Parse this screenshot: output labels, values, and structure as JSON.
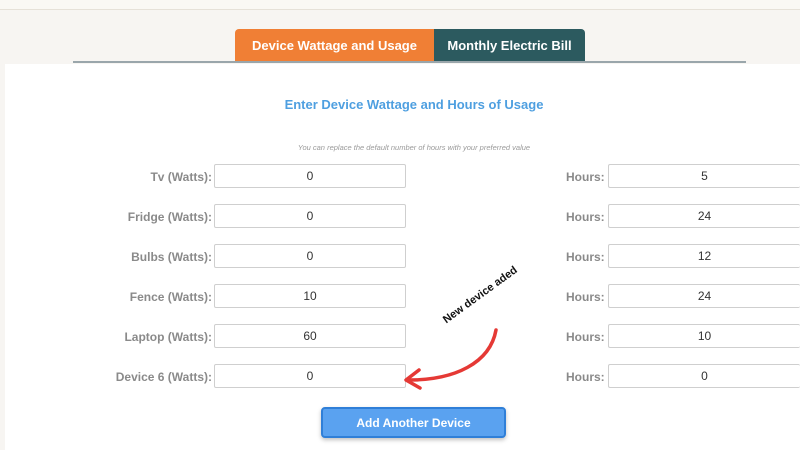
{
  "tabs": {
    "active_label": "Device Wattage and Usage",
    "inactive_label": "Monthly Electric Bill"
  },
  "form": {
    "heading": "Enter Device Wattage and Hours of Usage",
    "hint": "You can replace the default number of hours with your preferred value",
    "hours_label": "Hours:",
    "devices": [
      {
        "label": "Tv (Watts):",
        "watts": "0",
        "hours": "5"
      },
      {
        "label": "Fridge (Watts):",
        "watts": "0",
        "hours": "24"
      },
      {
        "label": "Bulbs (Watts):",
        "watts": "0",
        "hours": "12"
      },
      {
        "label": "Fence (Watts):",
        "watts": "10",
        "hours": "24"
      },
      {
        "label": "Laptop (Watts):",
        "watts": "60",
        "hours": "10"
      },
      {
        "label": "Device 6 (Watts):",
        "watts": "0",
        "hours": "0"
      }
    ],
    "add_button_label": "Add Another Device"
  },
  "annotation": {
    "text": "New device aded",
    "arrow_color": "#e53935"
  },
  "colors": {
    "tab_active": "#f07f35",
    "tab_inactive": "#2c5a5f",
    "heading": "#4e9fe0",
    "button": "#5aa2f0"
  }
}
